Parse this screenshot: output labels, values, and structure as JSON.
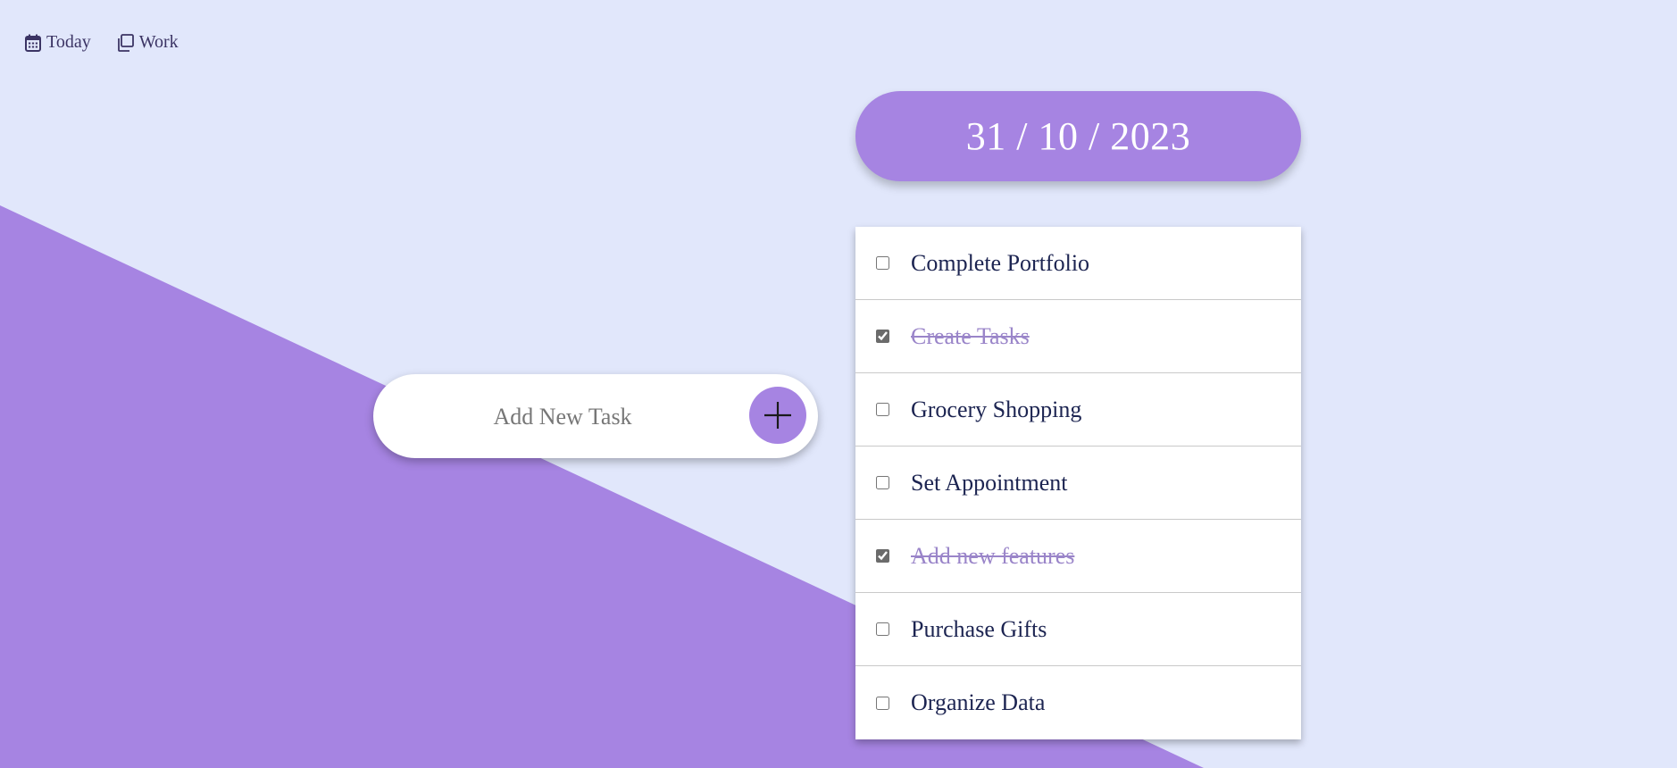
{
  "nav": {
    "items": [
      {
        "label": "Today",
        "icon": "calendar-icon"
      },
      {
        "label": "Work",
        "icon": "copy-icon"
      }
    ]
  },
  "date": {
    "text": "31 / 10 / 2023"
  },
  "add_task": {
    "placeholder": "Add New Task",
    "button_icon": "plus-icon"
  },
  "tasks": [
    {
      "label": "Complete Portfolio",
      "done": false
    },
    {
      "label": "Create Tasks",
      "done": true
    },
    {
      "label": "Grocery Shopping",
      "done": false
    },
    {
      "label": "Set Appointment",
      "done": false
    },
    {
      "label": "Add new features",
      "done": true
    },
    {
      "label": "Purchase Gifts",
      "done": false
    },
    {
      "label": "Organize Data",
      "done": false
    }
  ],
  "colors": {
    "background": "#e1e7fb",
    "accent": "#a684e2",
    "text": "#1c2451",
    "done_text": "#9a85c9"
  }
}
